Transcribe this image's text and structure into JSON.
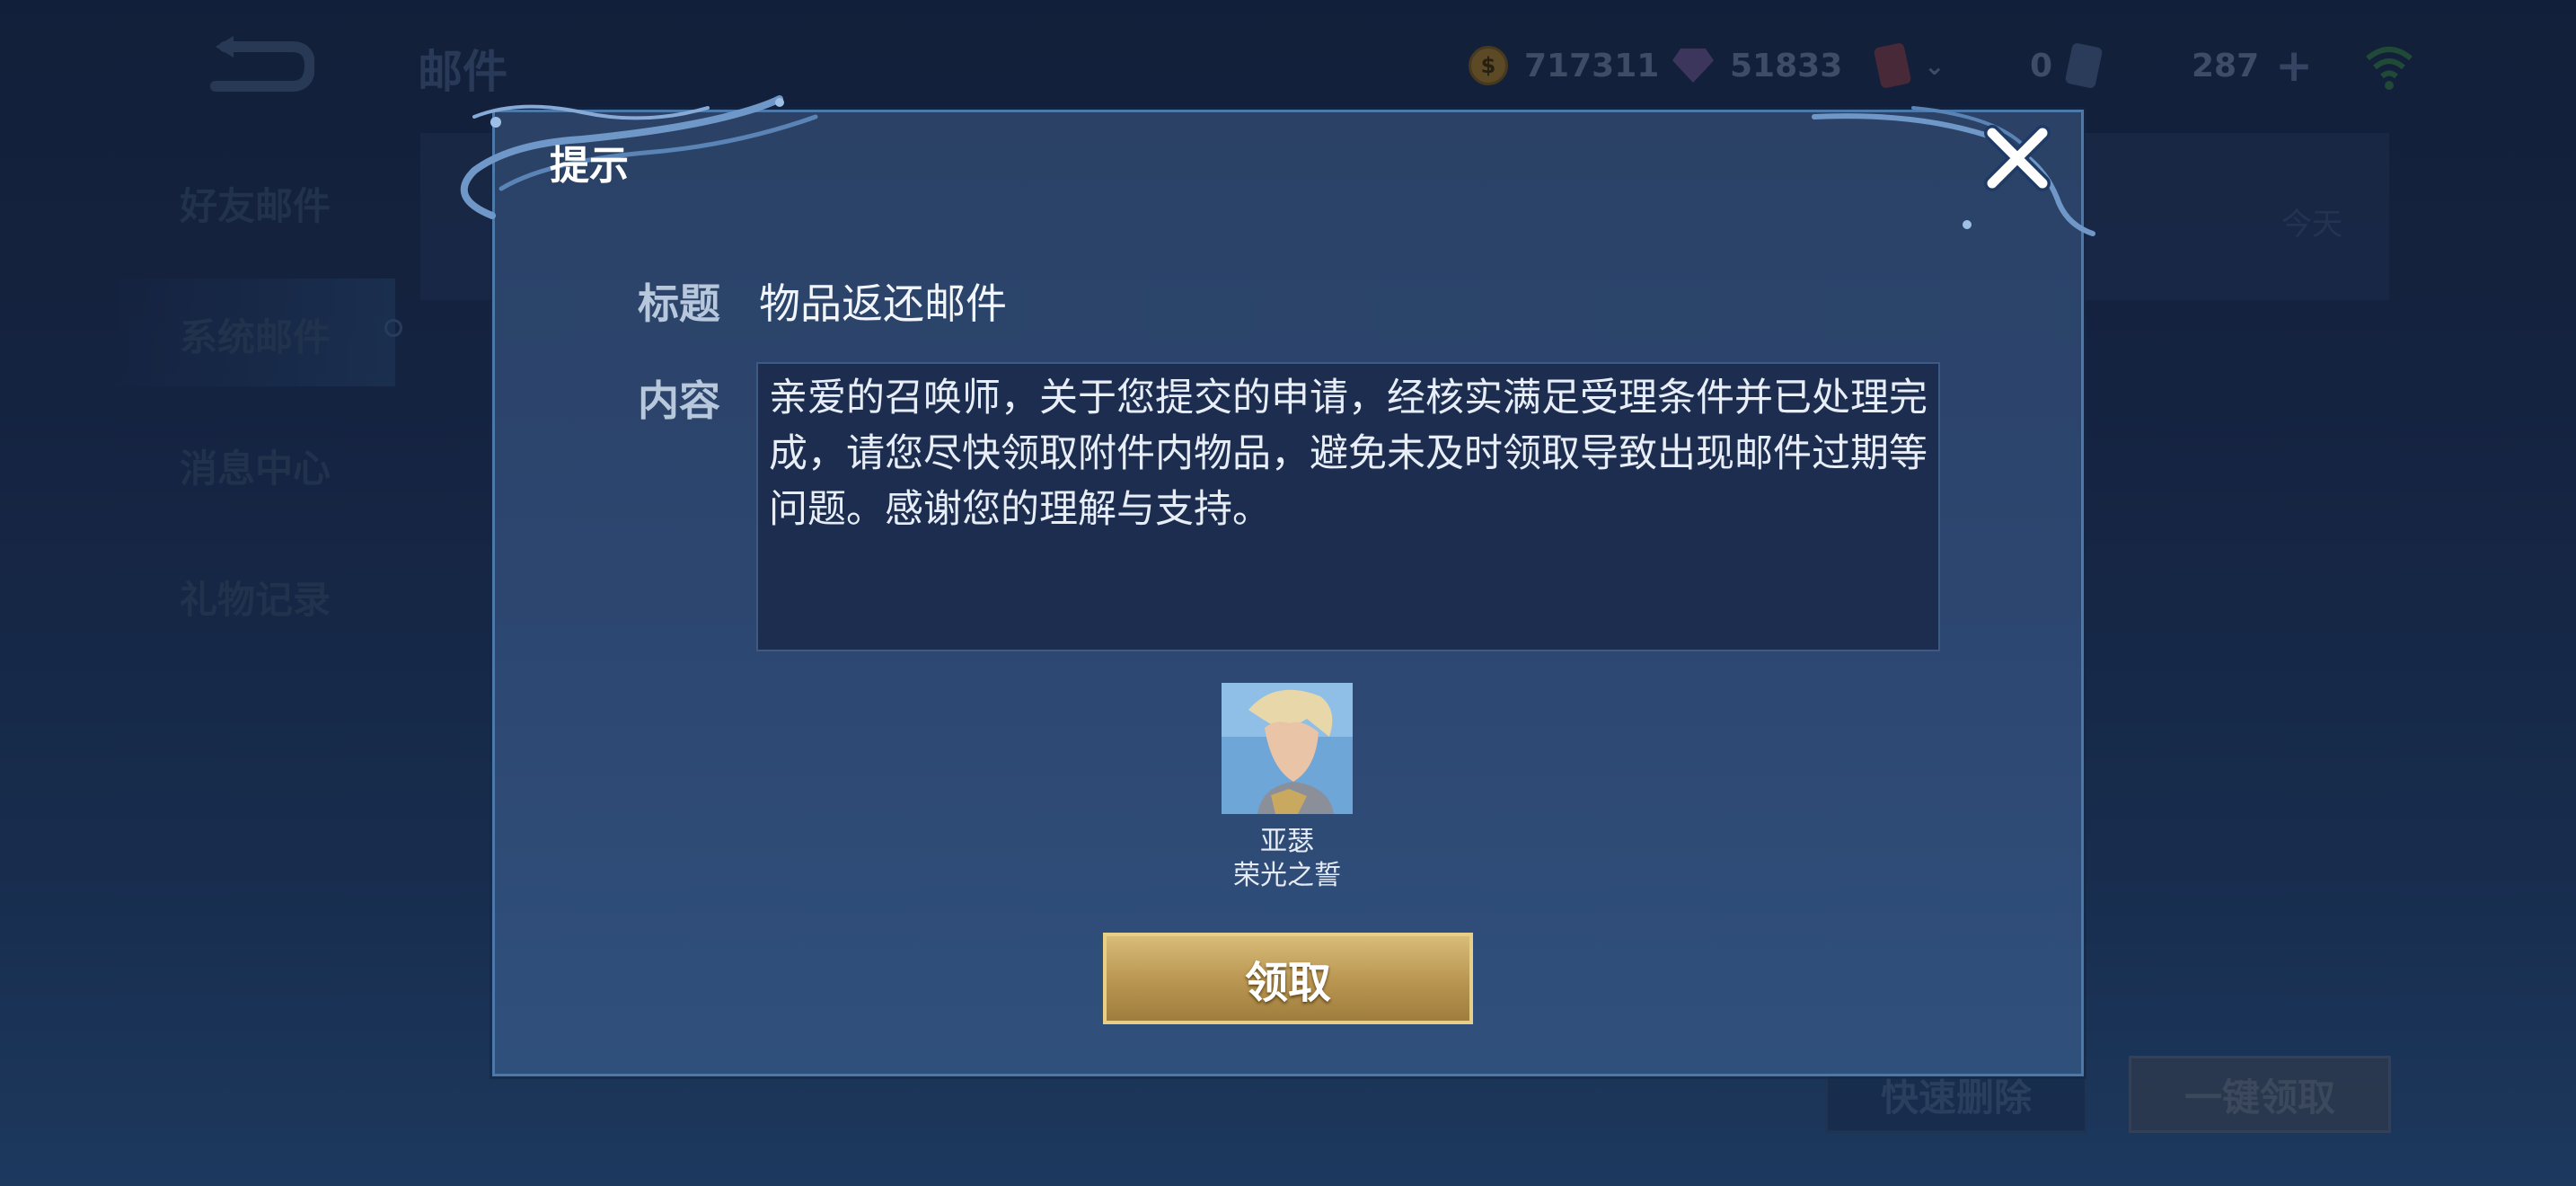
{
  "topbar": {
    "title": "邮件",
    "gold": "717311",
    "diamonds": "51833",
    "cards": "0",
    "vouchers": "287",
    "back_icon": "back-arrow-icon",
    "signal_icon": "wifi-icon"
  },
  "sidebar": {
    "items": [
      {
        "label": "好友邮件"
      },
      {
        "label": "系统邮件"
      },
      {
        "label": "消息中心"
      },
      {
        "label": "礼物记录"
      }
    ]
  },
  "mail_list": {
    "date": "今天"
  },
  "footer": {
    "quick_delete": "快速删除",
    "claim_all": "一键领取"
  },
  "dialog": {
    "title": "提示",
    "subject_label": "标题",
    "subject": "物品返还邮件",
    "content_label": "内容",
    "content": "亲爱的召唤师，关于您提交的申请，经核实满足受理条件并已处理完成，请您尽快领取附件内物品，避免未及时领取导致出现邮件过期等问题。感谢您的理解与支持。",
    "reward": {
      "hero": "亚瑟",
      "skin": "荣光之誓"
    },
    "claim_button": "领取",
    "colors": {
      "accent_gold": "#c9a95f",
      "panel": "#2c4670"
    }
  }
}
